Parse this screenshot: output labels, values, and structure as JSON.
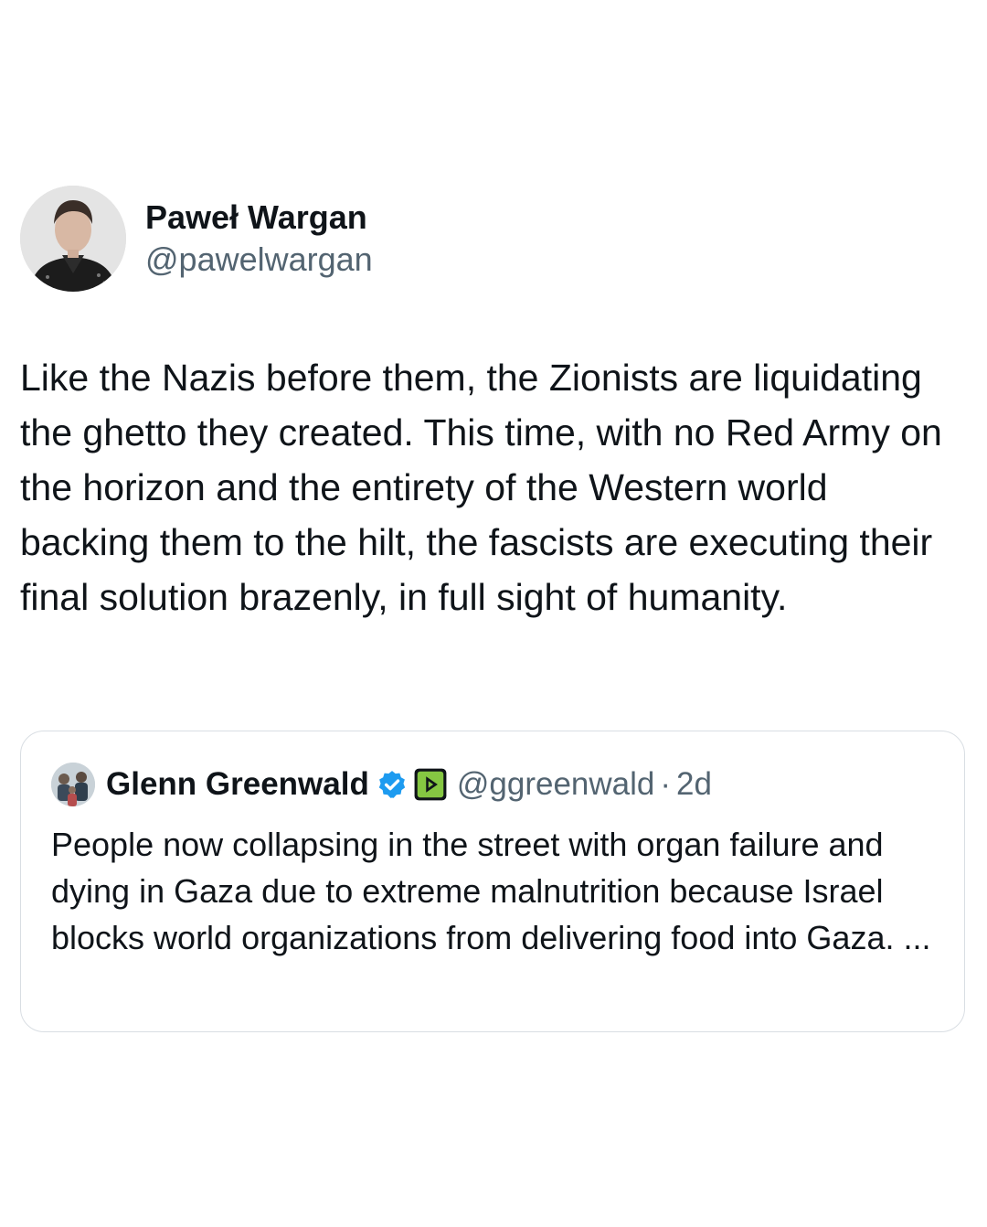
{
  "tweet": {
    "author": {
      "display_name": "Paweł Wargan",
      "handle": "@pawelwargan",
      "avatar_icon": "person-portrait-icon"
    },
    "text": "Like the Nazis before them, the Zionists are liquidating the ghetto they created. This time, with no Red Army on the horizon and the entirety of the Western world backing them to the hilt, the fascists are executing their final solution brazenly, in full sight of humanity."
  },
  "quote": {
    "author": {
      "display_name": "Glenn Greenwald",
      "handle": "@ggreenwald",
      "separator": "·",
      "time": "2d",
      "avatar_icon": "group-photo-icon",
      "verified_icon": "verified-badge-icon",
      "affiliate_icon": "rumble-logo-icon"
    },
    "text": "People now collapsing in the street with organ failure and dying in Gaza due to extreme malnutrition because Israel blocks world organizations from delivering food into Gaza. ..."
  },
  "colors": {
    "text_primary": "#0f1419",
    "text_secondary": "#536471",
    "border": "#d9dee3",
    "verified_blue": "#1d9bf0",
    "affiliate_green": "#85c742"
  }
}
